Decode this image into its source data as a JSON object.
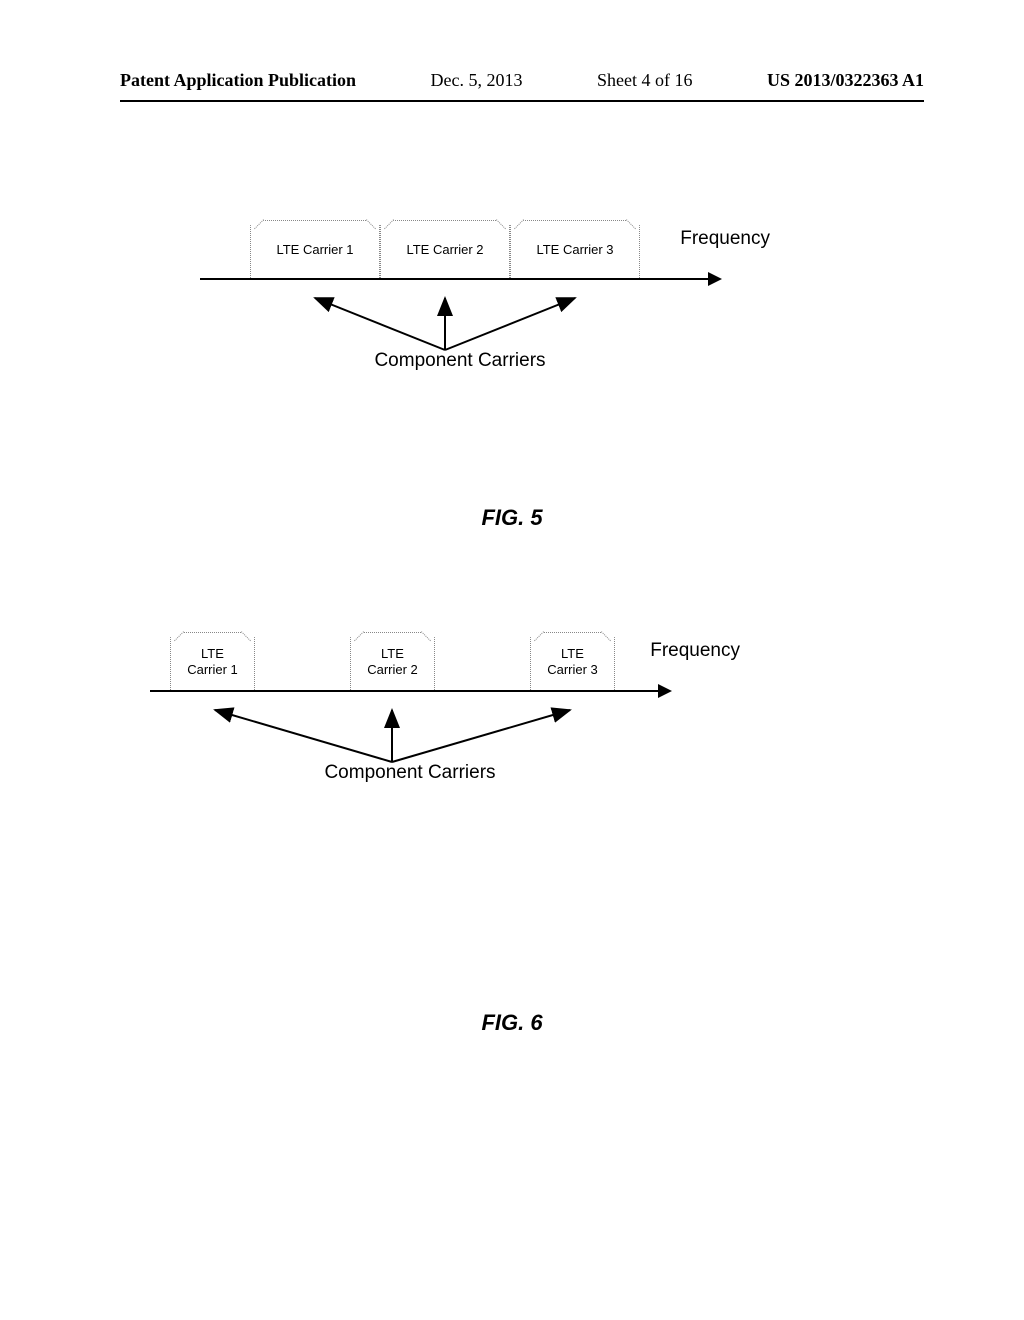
{
  "header": {
    "publication": "Patent Application Publication",
    "date": "Dec. 5, 2013",
    "sheet": "Sheet 4 of 16",
    "docnum": "US 2013/0322363 A1"
  },
  "common": {
    "freq_label": "Frequency",
    "cc_label": "Component Carriers"
  },
  "fig5": {
    "label": "FIG. 5",
    "carriers": [
      "LTE Carrier 1",
      "LTE Carrier 2",
      "LTE Carrier 3"
    ],
    "layout": "contiguous"
  },
  "fig6": {
    "label": "FIG. 6",
    "carriers": [
      "LTE\nCarrier 1",
      "LTE\nCarrier 2",
      "LTE\nCarrier 3"
    ],
    "layout": "non-contiguous"
  },
  "chart_data": [
    {
      "type": "diagram",
      "title": "FIG. 5 — contiguous component carriers",
      "xlabel": "Frequency",
      "series": [
        {
          "name": "LTE Carrier 1",
          "position": "contiguous-1"
        },
        {
          "name": "LTE Carrier 2",
          "position": "contiguous-2"
        },
        {
          "name": "LTE Carrier 3",
          "position": "contiguous-3"
        }
      ],
      "annotation": "Component Carriers"
    },
    {
      "type": "diagram",
      "title": "FIG. 6 — non-contiguous component carriers",
      "xlabel": "Frequency",
      "series": [
        {
          "name": "LTE Carrier 1",
          "position": "band-1"
        },
        {
          "name": "LTE Carrier 2",
          "position": "band-2"
        },
        {
          "name": "LTE Carrier 3",
          "position": "band-3"
        }
      ],
      "annotation": "Component Carriers"
    }
  ]
}
